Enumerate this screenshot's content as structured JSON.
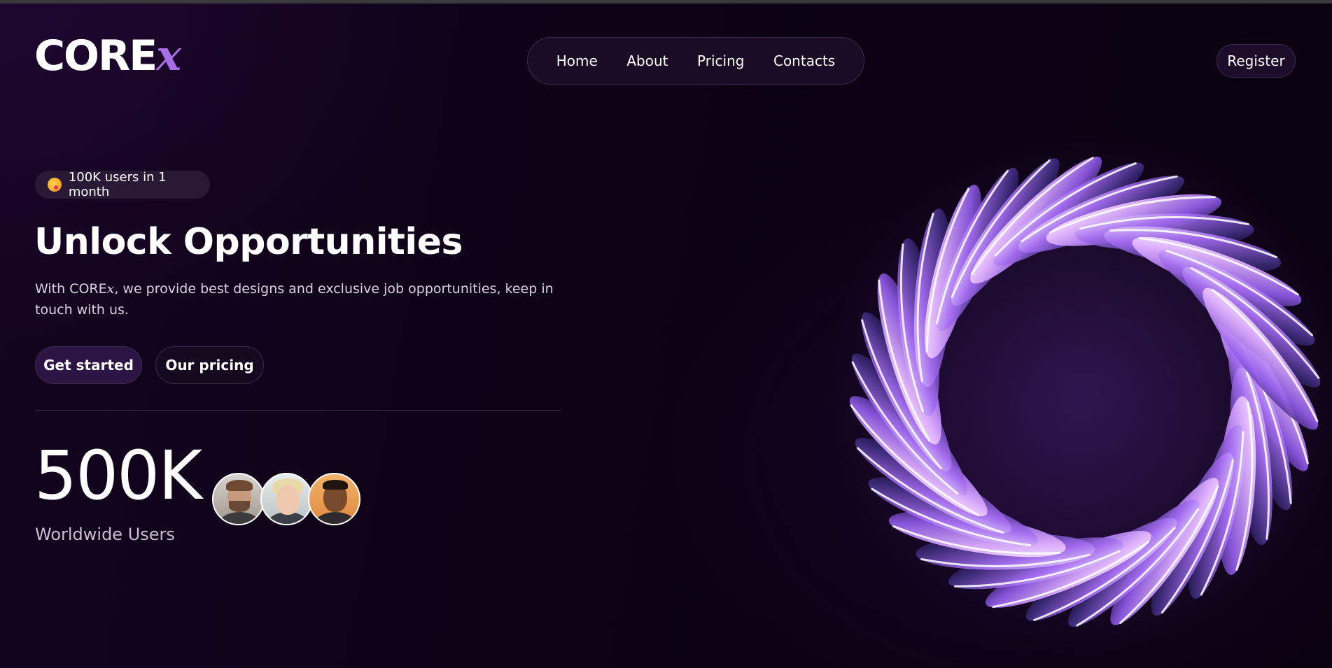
{
  "brand": {
    "name": "CORE",
    "suffix": "x"
  },
  "nav": {
    "items": [
      {
        "label": "Home"
      },
      {
        "label": "About"
      },
      {
        "label": "Pricing"
      },
      {
        "label": "Contacts"
      }
    ],
    "register_label": "Register"
  },
  "hero": {
    "badge_icon": "star-struck-emoji-icon",
    "badge_text": "100K users in 1 month",
    "title": "Unlock Opportunities",
    "lead_prefix": "With CORE",
    "lead_brand_suffix": "x",
    "lead_rest": ", we provide best designs and exclusive job opportunities, keep in touch with us.",
    "primary_button": "Get started",
    "secondary_button": "Our pricing"
  },
  "stats": {
    "number": "500K",
    "label": "Worldwide Users",
    "avatars": [
      "avatar-man-beard",
      "avatar-woman-blonde",
      "avatar-man-dark-hair"
    ]
  },
  "colors": {
    "background": "#0d0216",
    "accent": "#a86ee8",
    "primary_button": "#2c1545",
    "border": "#3b2b47"
  }
}
